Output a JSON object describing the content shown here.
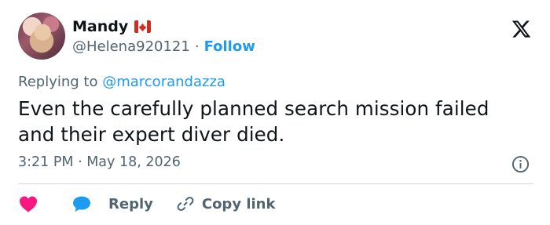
{
  "author": {
    "name": "Mandy",
    "flag_icon": "canada-flag-icon",
    "handle": "@Helena920121",
    "separator": "·",
    "follow_label": "Follow"
  },
  "reply_prefix": "Replying to",
  "reply_mention": "@marcorandazza",
  "tweet_text": "Even the carefully planned search mission failed and their expert diver died.",
  "timestamp": "3:21 PM · May 18, 2026",
  "actions": {
    "like_icon": "heart-icon",
    "reply_icon": "speech-bubble-icon",
    "reply_label": "Reply",
    "copy_icon": "link-icon",
    "copy_label": "Copy link"
  },
  "colors": {
    "accent": "#1d9bf0",
    "like": "#f91880",
    "muted": "#536471",
    "text": "#0f1419",
    "divider": "#cfd9de"
  }
}
